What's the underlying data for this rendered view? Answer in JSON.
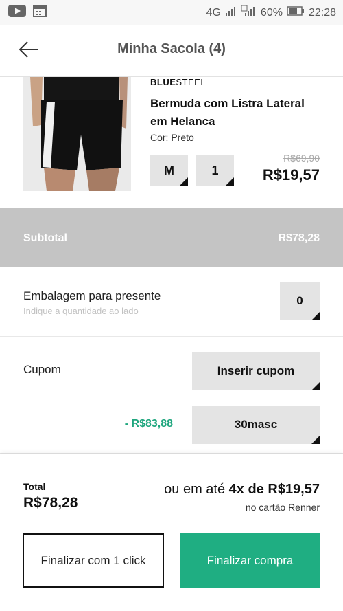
{
  "status_bar": {
    "network": "4G",
    "battery": "60%",
    "time": "22:28",
    "icons": [
      "youtube-icon",
      "calendar-icon",
      "signal-icon",
      "battery-icon"
    ]
  },
  "header": {
    "title": "Minha Sacola (4)",
    "back_icon": "arrow-left-icon"
  },
  "product": {
    "brand_bold": "BLUE",
    "brand_light": "STEEL",
    "name": "Bermuda com Listra Lateral em Helanca",
    "color": "Cor: Preto",
    "size": "M",
    "quantity": "1",
    "old_price": "R$69,90",
    "price": "R$19,57"
  },
  "subtotal": {
    "label": "Subtotal",
    "value": "R$78,28"
  },
  "gift": {
    "label": "Embalagem para presente",
    "hint": "Indique a quantidade ao lado",
    "quantity": "0"
  },
  "coupon": {
    "label": "Cupom",
    "insert_label": "Inserir cupom",
    "discount": "- R$83,88",
    "code": "30masc"
  },
  "total": {
    "label": "Total",
    "value": "R$78,28",
    "installment_prefix": "ou em até",
    "installment_value": "4x de R$19,57",
    "installment_note": "no cartão Renner"
  },
  "actions": {
    "one_click": "Finalizar com 1 click",
    "finish": "Finalizar compra"
  },
  "colors": {
    "accent": "#1fae82",
    "discount": "#1fa67e",
    "subtotal_bg": "#c4c4c4"
  }
}
